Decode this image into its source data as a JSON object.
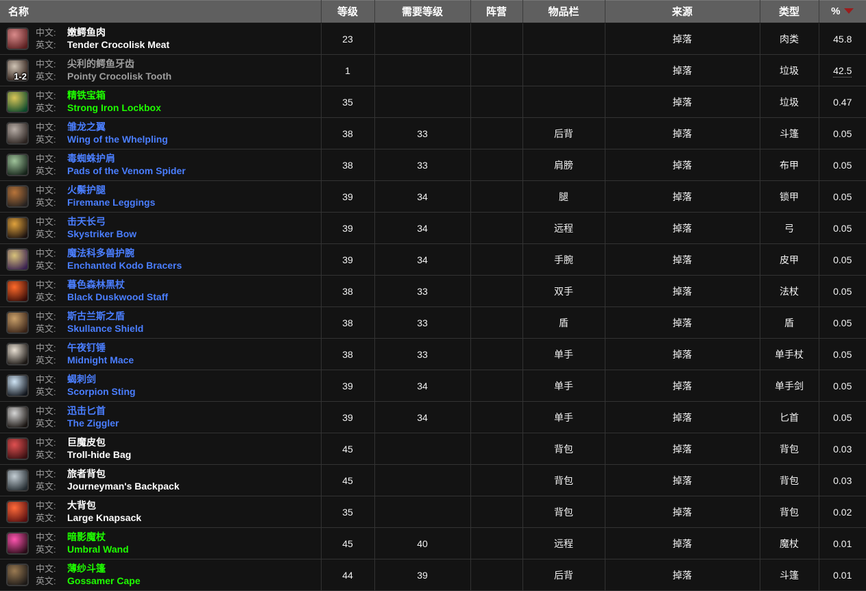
{
  "table": {
    "columns": [
      {
        "key": "name",
        "label": "名称"
      },
      {
        "key": "level",
        "label": "等级"
      },
      {
        "key": "req_level",
        "label": "需要等级"
      },
      {
        "key": "faction",
        "label": "阵营"
      },
      {
        "key": "slot",
        "label": "物品栏"
      },
      {
        "key": "source",
        "label": "来源"
      },
      {
        "key": "type",
        "label": "类型"
      },
      {
        "key": "percent",
        "label": "%"
      }
    ],
    "sorted_column": "percent",
    "sort_direction": "desc",
    "row_labels": {
      "cn": "中文:",
      "en": "英文:"
    },
    "colors": {
      "header_bg": "#5f5f5f",
      "row_bg": "#131313",
      "border": "#333333",
      "quality_common": "#ffffff",
      "quality_poor": "#9d9d9d",
      "quality_uncommon": "#1eff00",
      "quality_rare": "#4a7eff",
      "sort_arrow": "#9a1c1c"
    },
    "rows": [
      {
        "icon": "raw-meat-icon",
        "icon_from": "#d98a8a",
        "icon_to": "#5a1f20",
        "stack": "",
        "cn": "嫩鳄鱼肉",
        "en": "Tender Crocolisk Meat",
        "quality": "common",
        "level": "23",
        "req_level": "",
        "faction": "",
        "slot": "",
        "source": "掉落",
        "type": "肉类",
        "percent": "45.8",
        "percent_tooltip": false
      },
      {
        "icon": "tooth-icon",
        "icon_from": "#cfc3b4",
        "icon_to": "#2a1a14",
        "stack": "1-2",
        "cn": "尖利的鳄鱼牙齿",
        "en": "Pointy Crocolisk Tooth",
        "quality": "poor",
        "level": "1",
        "req_level": "",
        "faction": "",
        "slot": "",
        "source": "掉落",
        "type": "垃圾",
        "percent": "42.5",
        "percent_tooltip": true
      },
      {
        "icon": "lockbox-icon",
        "icon_from": "#d9c558",
        "icon_to": "#0e4a2c",
        "stack": "",
        "cn": "精铁宝箱",
        "en": "Strong Iron Lockbox",
        "quality": "uncommon",
        "level": "35",
        "req_level": "",
        "faction": "",
        "slot": "",
        "source": "掉落",
        "type": "垃圾",
        "percent": "0.47",
        "percent_tooltip": false
      },
      {
        "icon": "whelpling-wing-icon",
        "icon_from": "#b7ada6",
        "icon_to": "#2b2320",
        "stack": "",
        "cn": "雏龙之翼",
        "en": "Wing of the Whelpling",
        "quality": "rare",
        "level": "38",
        "req_level": "33",
        "faction": "",
        "slot": "后背",
        "source": "掉落",
        "type": "斗篷",
        "percent": "0.05",
        "percent_tooltip": false
      },
      {
        "icon": "shoulder-pads-icon",
        "icon_from": "#9fc39a",
        "icon_to": "#16241a",
        "stack": "",
        "cn": "毒蜘蛛护肩",
        "en": "Pads of the Venom Spider",
        "quality": "rare",
        "level": "38",
        "req_level": "33",
        "faction": "",
        "slot": "肩膀",
        "source": "掉落",
        "type": "布甲",
        "percent": "0.05",
        "percent_tooltip": false
      },
      {
        "icon": "leggings-icon",
        "icon_from": "#b8743a",
        "icon_to": "#262220",
        "stack": "",
        "cn": "火鬃护腿",
        "en": "Firemane Leggings",
        "quality": "rare",
        "level": "39",
        "req_level": "34",
        "faction": "",
        "slot": "腿",
        "source": "掉落",
        "type": "锁甲",
        "percent": "0.05",
        "percent_tooltip": false
      },
      {
        "icon": "bow-icon",
        "icon_from": "#e0a23c",
        "icon_to": "#1d1310",
        "stack": "",
        "cn": "击天长弓",
        "en": "Skystriker Bow",
        "quality": "rare",
        "level": "39",
        "req_level": "34",
        "faction": "",
        "slot": "远程",
        "source": "掉落",
        "type": "弓",
        "percent": "0.05",
        "percent_tooltip": false
      },
      {
        "icon": "bracers-icon",
        "icon_from": "#d8c27a",
        "icon_to": "#3a2150",
        "stack": "",
        "cn": "魔法科多兽护腕",
        "en": "Enchanted Kodo Bracers",
        "quality": "rare",
        "level": "39",
        "req_level": "34",
        "faction": "",
        "slot": "手腕",
        "source": "掉落",
        "type": "皮甲",
        "percent": "0.05",
        "percent_tooltip": false
      },
      {
        "icon": "staff-icon",
        "icon_from": "#ff6a2a",
        "icon_to": "#3a0d08",
        "stack": "",
        "cn": "暮色森林黑杖",
        "en": "Black Duskwood Staff",
        "quality": "rare",
        "level": "38",
        "req_level": "33",
        "faction": "",
        "slot": "双手",
        "source": "掉落",
        "type": "法杖",
        "percent": "0.05",
        "percent_tooltip": false
      },
      {
        "icon": "shield-icon",
        "icon_from": "#c9a06a",
        "icon_to": "#3a2418",
        "stack": "",
        "cn": "斯古兰斯之盾",
        "en": "Skullance Shield",
        "quality": "rare",
        "level": "38",
        "req_level": "33",
        "faction": "",
        "slot": "盾",
        "source": "掉落",
        "type": "盾",
        "percent": "0.05",
        "percent_tooltip": false
      },
      {
        "icon": "mace-skull-icon",
        "icon_from": "#e8dfd2",
        "icon_to": "#1b1714",
        "stack": "",
        "cn": "午夜钉锤",
        "en": "Midnight Mace",
        "quality": "rare",
        "level": "38",
        "req_level": "33",
        "faction": "",
        "slot": "单手",
        "source": "掉落",
        "type": "单手杖",
        "percent": "0.05",
        "percent_tooltip": false
      },
      {
        "icon": "sword-icon",
        "icon_from": "#cfe4f5",
        "icon_to": "#13171e",
        "stack": "",
        "cn": "蝎刺剑",
        "en": "Scorpion Sting",
        "quality": "rare",
        "level": "39",
        "req_level": "34",
        "faction": "",
        "slot": "单手",
        "source": "掉落",
        "type": "单手剑",
        "percent": "0.05",
        "percent_tooltip": false
      },
      {
        "icon": "dagger-icon",
        "icon_from": "#d5d5d5",
        "icon_to": "#1a1512",
        "stack": "",
        "cn": "迅击匕首",
        "en": "The Ziggler",
        "quality": "rare",
        "level": "39",
        "req_level": "34",
        "faction": "",
        "slot": "单手",
        "source": "掉落",
        "type": "匕首",
        "percent": "0.05",
        "percent_tooltip": false
      },
      {
        "icon": "bag-icon",
        "icon_from": "#e05050",
        "icon_to": "#3a1012",
        "stack": "",
        "cn": "巨魔皮包",
        "en": "Troll-hide Bag",
        "quality": "common",
        "level": "45",
        "req_level": "",
        "faction": "",
        "slot": "背包",
        "source": "掉落",
        "type": "背包",
        "percent": "0.03",
        "percent_tooltip": false
      },
      {
        "icon": "backpack-icon",
        "icon_from": "#c3cdd4",
        "icon_to": "#242c31",
        "stack": "",
        "cn": "旅者背包",
        "en": "Journeyman's Backpack",
        "quality": "common",
        "level": "45",
        "req_level": "",
        "faction": "",
        "slot": "背包",
        "source": "掉落",
        "type": "背包",
        "percent": "0.03",
        "percent_tooltip": false
      },
      {
        "icon": "knapsack-icon",
        "icon_from": "#ff6a3a",
        "icon_to": "#5a1010",
        "stack": "",
        "cn": "大背包",
        "en": "Large Knapsack",
        "quality": "common",
        "level": "35",
        "req_level": "",
        "faction": "",
        "slot": "背包",
        "source": "掉落",
        "type": "背包",
        "percent": "0.02",
        "percent_tooltip": false
      },
      {
        "icon": "wand-icon",
        "icon_from": "#ff55b0",
        "icon_to": "#2a0c18",
        "stack": "",
        "cn": "暗影魔杖",
        "en": "Umbral Wand",
        "quality": "uncommon",
        "level": "45",
        "req_level": "40",
        "faction": "",
        "slot": "远程",
        "source": "掉落",
        "type": "魔杖",
        "percent": "0.01",
        "percent_tooltip": false
      },
      {
        "icon": "cape-icon",
        "icon_from": "#9a7a52",
        "icon_to": "#1d1a18",
        "stack": "",
        "cn": "薄纱斗篷",
        "en": "Gossamer Cape",
        "quality": "uncommon",
        "level": "44",
        "req_level": "39",
        "faction": "",
        "slot": "后背",
        "source": "掉落",
        "type": "斗篷",
        "percent": "0.01",
        "percent_tooltip": false
      }
    ]
  }
}
